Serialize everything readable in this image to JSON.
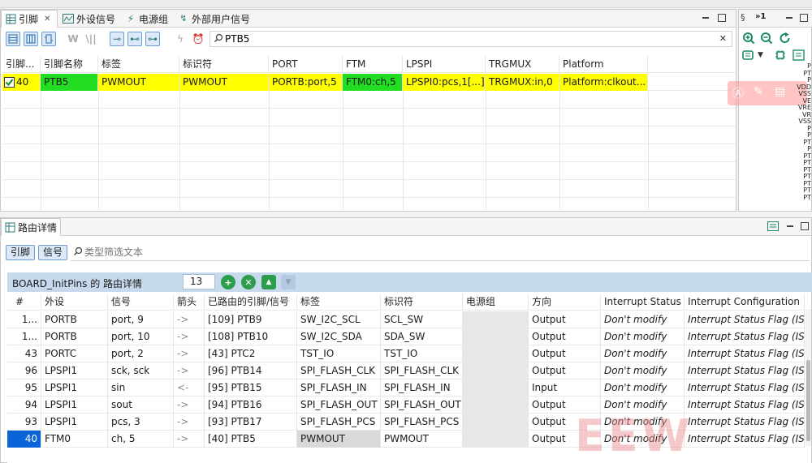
{
  "top_tabs": {
    "pins": "引脚",
    "peripheral_signals": "外设信号",
    "power_groups": "电源组",
    "external_user_signals": "外部用户信号",
    "close_glyph": "✕"
  },
  "filter": {
    "value": "PTB5"
  },
  "pins_table": {
    "headers": [
      "引脚...",
      "引脚名称",
      "标签",
      "标识符",
      "PORT",
      "FTM",
      "LPSPI",
      "TRGMUX",
      "Platform"
    ],
    "row": [
      "40",
      "PTB5",
      "PWMOUT",
      "PWMOUT",
      "PORTB:port,5",
      "FTM0:ch,5",
      "LPSPI0:pcs,1[...]",
      "TRGMUX:in,0",
      "Platform:clkout..."
    ]
  },
  "right_panel": {
    "tab_label": "»1",
    "side_labels": [
      "P",
      "PT",
      "P",
      "VDD",
      "VSS",
      "VE",
      "VRE",
      "VR",
      "VSS",
      "P",
      "P",
      "PT",
      "P",
      "PT",
      "PT",
      "PT",
      "PT",
      "PT",
      "PT",
      "PT"
    ]
  },
  "routing": {
    "tab_title": "路由详情",
    "mode_pins": "引脚",
    "mode_signals": "信号",
    "filter_placeholder": "类型筛选文本",
    "panel_title": "BOARD_InitPins 的 路由详情",
    "count": "13",
    "headers": [
      "#",
      "外设",
      "信号",
      "箭头",
      "已路由的引脚/信号",
      "标签",
      "标识符",
      "电源组",
      "方向",
      "Interrupt Status",
      "Interrupt Configuration"
    ],
    "rows": [
      [
        "1...",
        "PORTB",
        "port, 9",
        "->",
        "[109] PTB9",
        "SW_I2C_SCL",
        "SCL_SW",
        "",
        "Output",
        "Don't modify",
        "Interrupt Status Flag (IS"
      ],
      [
        "1...",
        "PORTB",
        "port, 10",
        "->",
        "[108] PTB10",
        "SW_I2C_SDA",
        "SDA_SW",
        "",
        "Output",
        "Don't modify",
        "Interrupt Status Flag (IS"
      ],
      [
        "43",
        "PORTC",
        "port, 2",
        "->",
        "[43] PTC2",
        "TST_IO",
        "TST_IO",
        "",
        "Output",
        "Don't modify",
        "Interrupt Status Flag (IS"
      ],
      [
        "96",
        "LPSPI1",
        "sck, sck",
        "->",
        "[96] PTB14",
        "SPI_FLASH_CLK",
        "SPI_FLASH_CLK",
        "",
        "Output",
        "Don't modify",
        "Interrupt Status Flag (IS"
      ],
      [
        "95",
        "LPSPI1",
        "sin",
        "<-",
        "[95] PTB15",
        "SPI_FLASH_IN",
        "SPI_FLASH_IN",
        "",
        "Input",
        "Don't modify",
        "Interrupt Status Flag (IS"
      ],
      [
        "94",
        "LPSPI1",
        "sout",
        "->",
        "[94] PTB16",
        "SPI_FLASH_OUT",
        "SPI_FLASH_OUT",
        "",
        "Output",
        "Don't modify",
        "Interrupt Status Flag (IS"
      ],
      [
        "93",
        "LPSPI1",
        "pcs, 3",
        "->",
        "[93] PTB17",
        "SPI_FLASH_PCS",
        "SPI_FLASH_PCS",
        "",
        "Output",
        "Don't modify",
        "Interrupt Status Flag (IS"
      ],
      [
        "40",
        "FTM0",
        "ch, 5",
        "->",
        "[40] PTB5",
        "PWMOUT",
        "PWMOUT",
        "",
        "Output",
        "Don't modify",
        "Interrupt Status Flag (IS"
      ]
    ]
  },
  "colors": {
    "selected_yellow": "#ffff00",
    "selected_green": "#22dd22",
    "selection_blue": "#0a64d8",
    "accent_blue": "#6d9ed3",
    "round_button_green": "#2e9d4b"
  },
  "watermark": "EEW"
}
